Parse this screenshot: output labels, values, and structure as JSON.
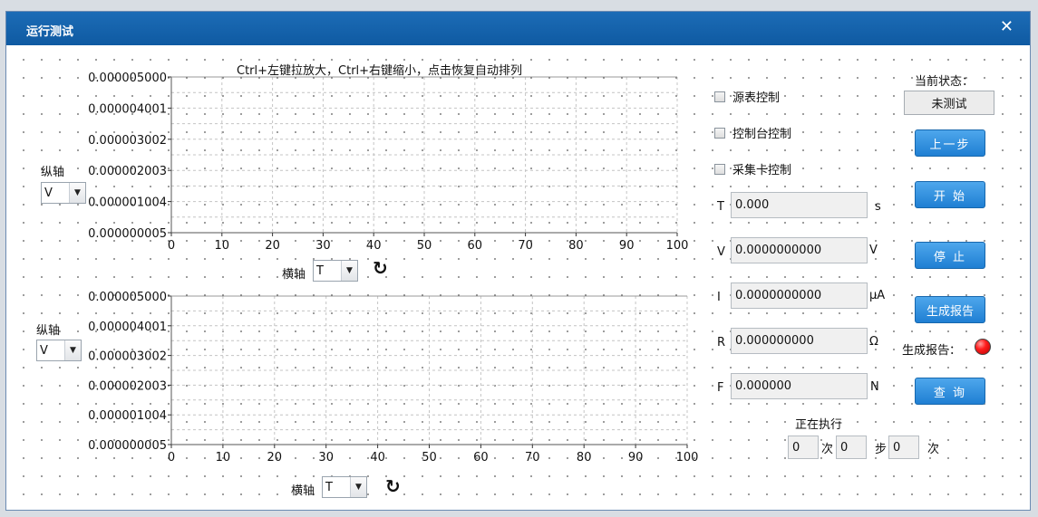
{
  "window": {
    "title": "运行测试"
  },
  "hint_text": "Ctrl+左键拉放大，Ctrl+右键缩小，点击恢复自动排列",
  "plots": [
    {
      "y_axis_label": "纵轴",
      "y_select_value": "V",
      "x_axis_label": "横轴",
      "x_select_value": "T",
      "y_ticks": [
        "0.000005000",
        "0.000004001",
        "0.000003002",
        "0.000002003",
        "0.000001004",
        "0.000000005"
      ],
      "x_ticks": [
        "0",
        "10",
        "20",
        "30",
        "40",
        "50",
        "60",
        "70",
        "80",
        "90",
        "100"
      ]
    },
    {
      "y_axis_label": "纵轴",
      "y_select_value": "V",
      "x_axis_label": "横轴",
      "x_select_value": "T",
      "y_ticks": [
        "0.000005000",
        "0.000004001",
        "0.000003002",
        "0.000002003",
        "0.000001004",
        "0.000000005"
      ],
      "x_ticks": [
        "0",
        "10",
        "20",
        "30",
        "40",
        "50",
        "60",
        "70",
        "80",
        "90",
        "100"
      ]
    }
  ],
  "controls": {
    "checkboxes": [
      "源表控制",
      "控制台控制",
      "采集卡控制"
    ],
    "fields": [
      {
        "label": "T",
        "value": "0.000",
        "unit": "s"
      },
      {
        "label": "V",
        "value": "0.0000000000",
        "unit": "V"
      },
      {
        "label": "I",
        "value": "0.0000000000",
        "unit": "μA"
      },
      {
        "label": "R",
        "value": "0.000000000",
        "unit": "Ω"
      },
      {
        "label": "F",
        "value": "0.000000",
        "unit": "N"
      }
    ],
    "executing_label": "正在执行",
    "exec_fields": [
      {
        "value": "0",
        "suffix": "次"
      },
      {
        "value": "0",
        "suffix": "步"
      },
      {
        "value": "0",
        "suffix": "次"
      }
    ]
  },
  "status": {
    "current_state_label": "当前状态：",
    "current_state_value": "未测试",
    "report_label": "生成报告：",
    "report_led_color": "#ff1d1d"
  },
  "buttons": {
    "prev_step": "上一步",
    "start": "开 始",
    "stop": "停 止",
    "generate_report": "生成报告",
    "query": "查 询"
  }
}
